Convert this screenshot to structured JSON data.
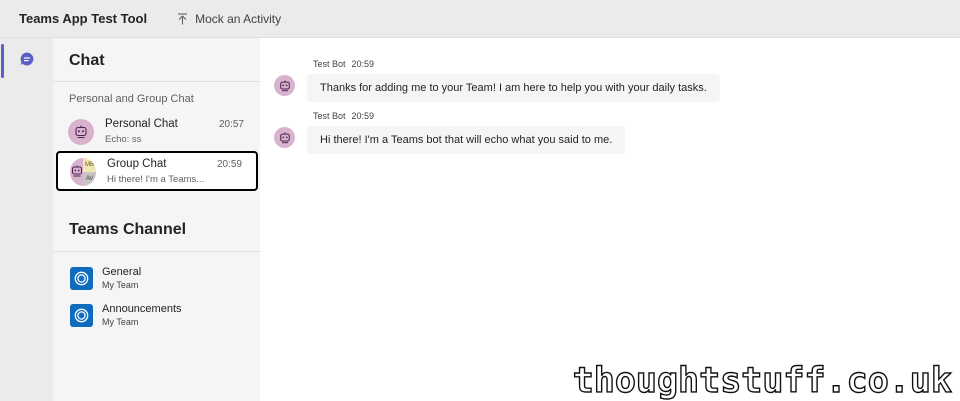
{
  "topbar": {
    "app_title": "Teams App Test Tool",
    "mock_activity_label": "Mock an Activity",
    "mock_activity_icon": "upload-arrow-icon"
  },
  "rail": {
    "items": [
      {
        "icon": "chat-icon",
        "active": true
      }
    ]
  },
  "sidebar": {
    "chat_heading": "Chat",
    "chat_section_label": "Personal and Group Chat",
    "chats": [
      {
        "name": "Personal Chat",
        "time": "20:57",
        "preview": "Echo: ss"
      },
      {
        "name": "Group Chat",
        "time": "20:59",
        "preview": "Hi there! I'm a Teams...",
        "avatar_initials": [
          "MB",
          "AV"
        ],
        "selected": true
      }
    ],
    "channel_heading": "Teams Channel",
    "channels": [
      {
        "name": "General",
        "team": "My Team"
      },
      {
        "name": "Announcements",
        "team": "My Team"
      }
    ]
  },
  "messages": [
    {
      "sender": "Test Bot",
      "time": "20:59",
      "text": "Thanks for adding me to your Team! I am here to help you with your daily tasks."
    },
    {
      "sender": "Test Bot",
      "time": "20:59",
      "text": "Hi there! I'm a Teams bot that will echo what you said to me."
    }
  ],
  "watermark": "thoughtstuff.co.uk",
  "colors": {
    "accent": "#5b5fc7",
    "bot_avatar": "#d9b3cd",
    "channel_icon": "#0f6cbd"
  }
}
